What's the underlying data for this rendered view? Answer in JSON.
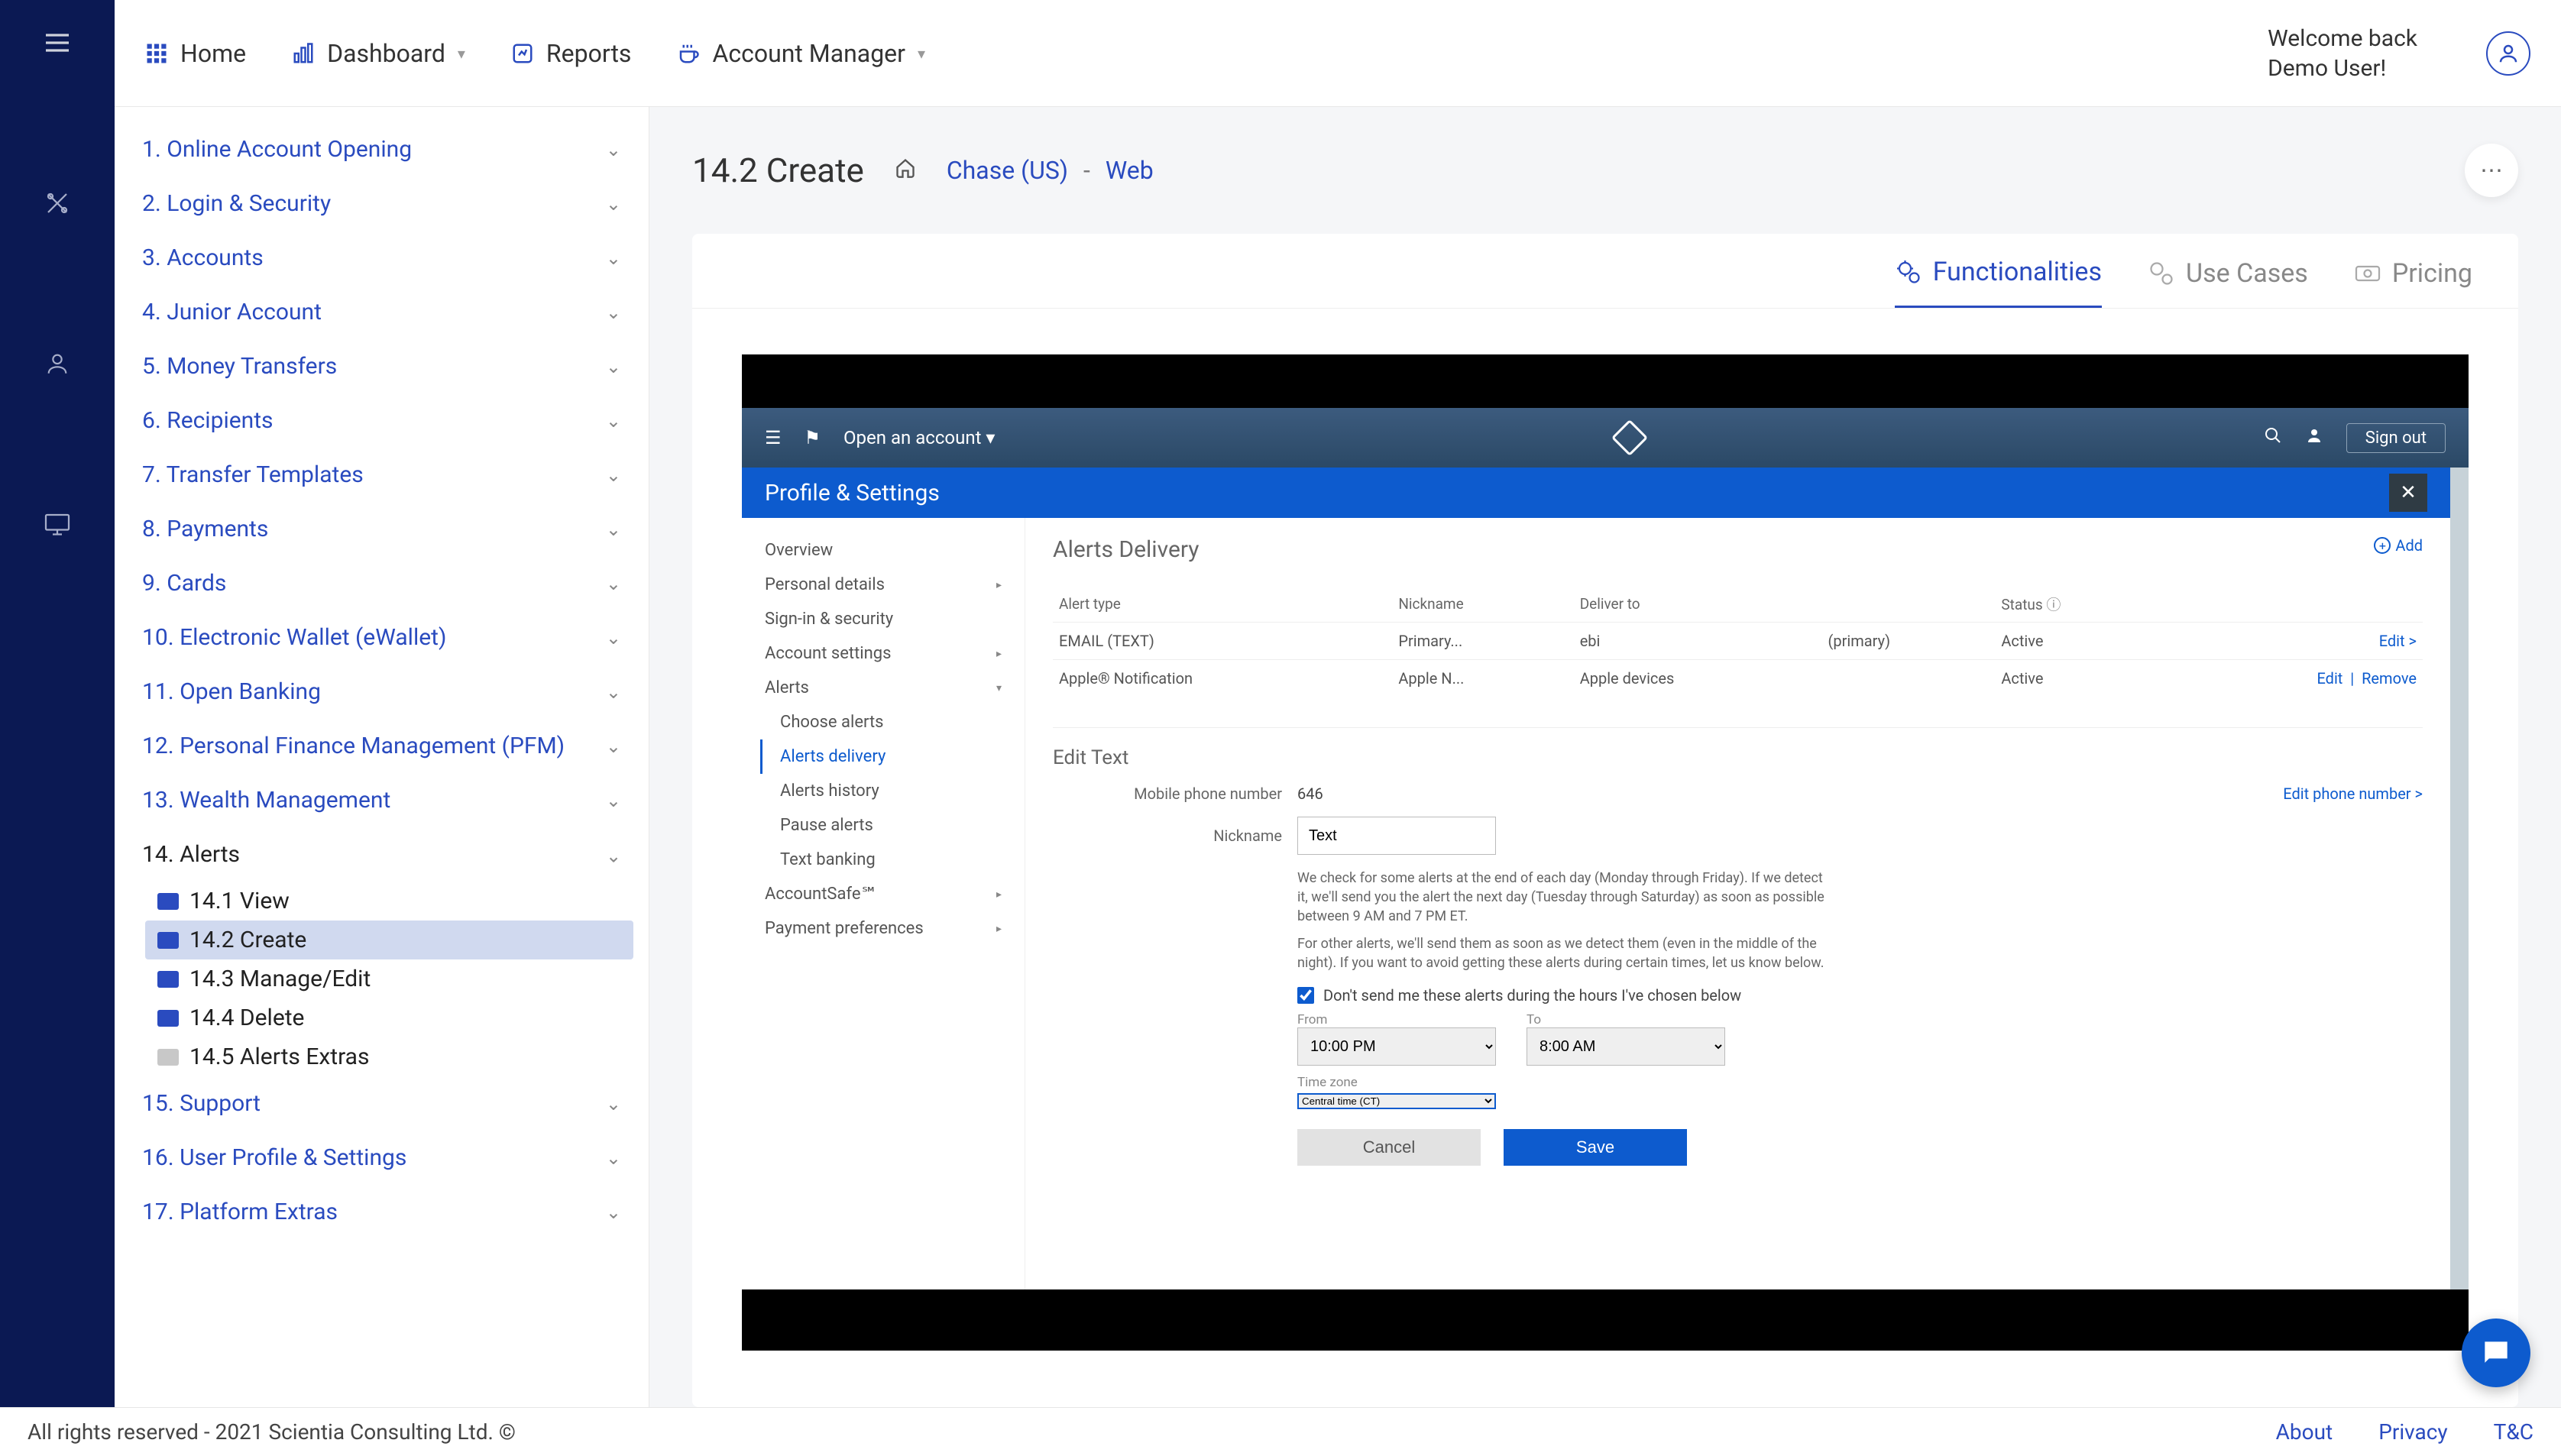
{
  "topnav": {
    "home": "Home",
    "dashboard": "Dashboard",
    "reports": "Reports",
    "account_manager": "Account Manager",
    "welcome_line1": "Welcome back",
    "welcome_line2": "Demo User!"
  },
  "sidebar": {
    "items": [
      "1. Online Account Opening",
      "2. Login & Security",
      "3. Accounts",
      "4. Junior Account",
      "5. Money Transfers",
      "6. Recipients",
      "7. Transfer Templates",
      "8. Payments",
      "9. Cards",
      "10. Electronic Wallet (eWallet)",
      "11. Open Banking",
      "12. Personal Finance Management (PFM)",
      "13. Wealth Management"
    ],
    "alerts_label": "14. Alerts",
    "alerts_children": [
      {
        "label": "14.1 View"
      },
      {
        "label": "14.2 Create"
      },
      {
        "label": "14.3 Manage/Edit"
      },
      {
        "label": "14.4 Delete"
      },
      {
        "label": "14.5 Alerts Extras"
      }
    ],
    "tail_items": [
      "15. Support",
      "16. User Profile & Settings",
      "17. Platform Extras"
    ]
  },
  "crumbs": {
    "page_title": "14.2 Create",
    "link1": "Chase (US)",
    "sep": "-",
    "link2": "Web"
  },
  "tabs": {
    "functionalities": "Functionalities",
    "usecases": "Use Cases",
    "pricing": "Pricing"
  },
  "chase": {
    "open_account": "Open an account",
    "signout": "Sign out",
    "panel_title": "Profile & Settings",
    "side": {
      "overview": "Overview",
      "personal": "Personal details",
      "signin": "Sign-in & security",
      "accsettings": "Account settings",
      "alerts": "Alerts",
      "choose": "Choose alerts",
      "delivery": "Alerts delivery",
      "history": "Alerts history",
      "pause": "Pause alerts",
      "textbank": "Text banking",
      "accountsafe": "AccountSafe℠",
      "payment": "Payment preferences"
    },
    "main": {
      "title": "Alerts Delivery",
      "add": "Add",
      "th_type": "Alert type",
      "th_nick": "Nickname",
      "th_deliver": "Deliver to",
      "th_status": "Status",
      "row1": {
        "type": "EMAIL (TEXT)",
        "nick": "Primary...",
        "deliver": "ebi",
        "extra": "(primary)",
        "status": "Active",
        "action": "Edit >"
      },
      "row2": {
        "type": "Apple® Notification",
        "nick": "Apple N...",
        "deliver": "Apple devices",
        "status": "Active",
        "a1": "Edit",
        "a2": "Remove"
      },
      "edit_title": "Edit Text",
      "mobile_lbl": "Mobile phone number",
      "mobile_val": "646",
      "edit_phone": "Edit phone number  >",
      "nick_lbl": "Nickname",
      "nick_val": "Text",
      "help1": "We check for some alerts at the end of each day (Monday through Friday). If we detect it, we'll send you the alert the next day (Tuesday through Saturday) as soon as possible between 9 AM and 7 PM ET.",
      "help2": "For other alerts, we'll send them as soon as we detect them (even in the middle of the night). If you want to avoid getting these alerts during certain times, let us know below.",
      "chk_label": "Don't send me these alerts during the hours I've chosen below",
      "from_lbl": "From",
      "from_val": "10:00 PM",
      "to_lbl": "To",
      "to_val": "8:00 AM",
      "tz_lbl": "Time zone",
      "tz_val": "Central time (CT)",
      "cancel": "Cancel",
      "save": "Save"
    }
  },
  "footer": {
    "copy": "All rights reserved - 2021 Scientia Consulting Ltd. ©",
    "about": "About",
    "privacy": "Privacy",
    "tc": "T&C"
  }
}
